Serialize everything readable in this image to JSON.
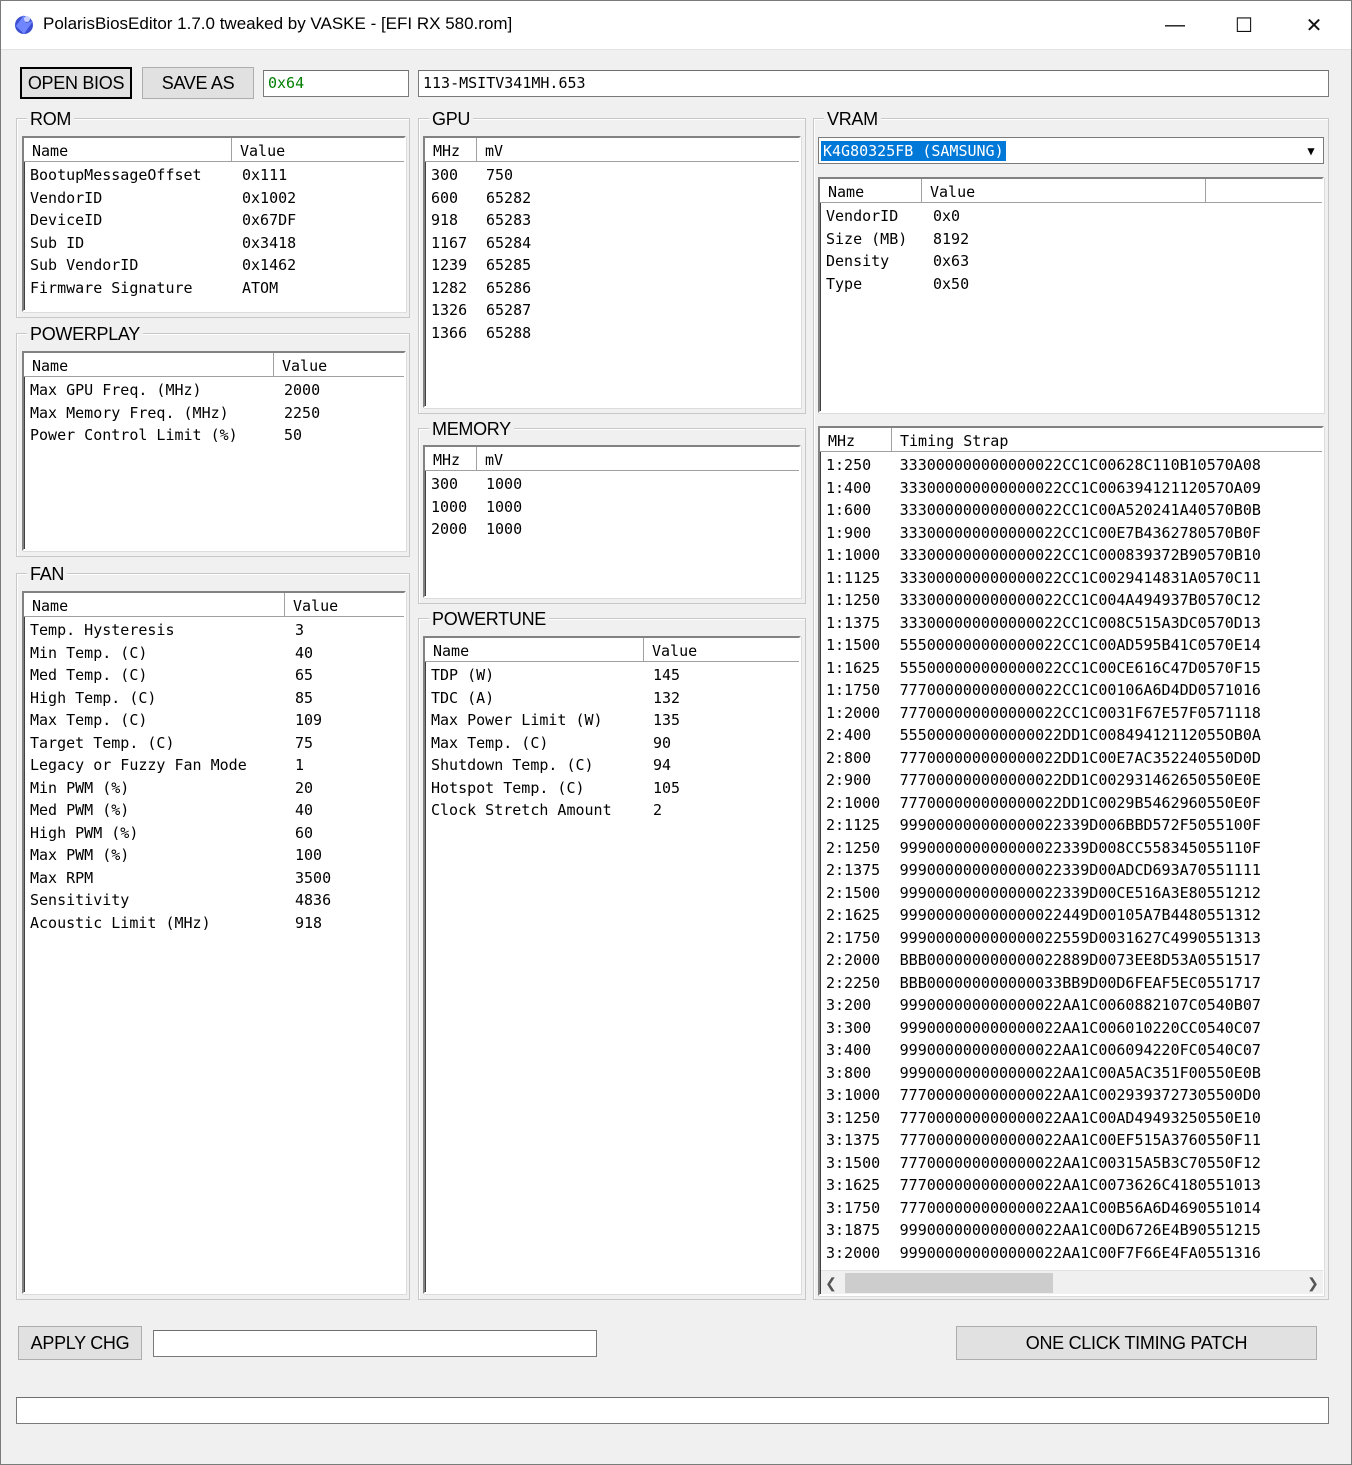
{
  "window": {
    "title": "PolarisBiosEditor 1.7.0 tweaked by VASKE - [EFI RX 580.rom]",
    "minimize": "—",
    "maximize": "☐",
    "close": "✕"
  },
  "toolbar": {
    "open_bios": "OPEN BIOS",
    "save_as": "SAVE AS",
    "checksum": "0x64",
    "checksum_color": "#008000",
    "bios_part_number": "113-MSITV341MH.653"
  },
  "rom": {
    "label": "ROM",
    "columns": [
      "Name",
      "Value"
    ],
    "rows": [
      [
        "BootupMessageOffset",
        "0x111"
      ],
      [
        "VendorID",
        "0x1002"
      ],
      [
        "DeviceID",
        "0x67DF"
      ],
      [
        "Sub ID",
        "0x3418"
      ],
      [
        "Sub VendorID",
        "0x1462"
      ],
      [
        "Firmware Signature",
        "ATOM"
      ]
    ]
  },
  "powerplay": {
    "label": "POWERPLAY",
    "columns": [
      "Name",
      "Value"
    ],
    "rows": [
      [
        "Max GPU Freq. (MHz)",
        "2000"
      ],
      [
        "Max Memory Freq. (MHz)",
        "2250"
      ],
      [
        "Power Control Limit (%)",
        "50"
      ]
    ]
  },
  "fan": {
    "label": "FAN",
    "columns": [
      "Name",
      "Value"
    ],
    "rows": [
      [
        "Temp. Hysteresis",
        "3"
      ],
      [
        "Min Temp. (C)",
        "40"
      ],
      [
        "Med Temp. (C)",
        "65"
      ],
      [
        "High Temp. (C)",
        "85"
      ],
      [
        "Max Temp. (C)",
        "109"
      ],
      [
        "Target Temp. (C)",
        "75"
      ],
      [
        "Legacy or Fuzzy Fan Mode",
        "1"
      ],
      [
        "Min PWM (%)",
        "20"
      ],
      [
        "Med PWM (%)",
        "40"
      ],
      [
        "High PWM (%)",
        "60"
      ],
      [
        "Max PWM (%)",
        "100"
      ],
      [
        "Max RPM",
        "3500"
      ],
      [
        "Sensitivity",
        "4836"
      ],
      [
        "Acoustic Limit (MHz)",
        "918"
      ]
    ]
  },
  "gpu": {
    "label": "GPU",
    "columns": [
      "MHz",
      "mV"
    ],
    "rows": [
      [
        "300",
        "750"
      ],
      [
        "600",
        "65282"
      ],
      [
        "918",
        "65283"
      ],
      [
        "1167",
        "65284"
      ],
      [
        "1239",
        "65285"
      ],
      [
        "1282",
        "65286"
      ],
      [
        "1326",
        "65287"
      ],
      [
        "1366",
        "65288"
      ]
    ]
  },
  "memory": {
    "label": "MEMORY",
    "columns": [
      "MHz",
      "mV"
    ],
    "rows": [
      [
        "300",
        "1000"
      ],
      [
        "1000",
        "1000"
      ],
      [
        "2000",
        "1000"
      ]
    ]
  },
  "powertune": {
    "label": "POWERTUNE",
    "columns": [
      "Name",
      "Value"
    ],
    "rows": [
      [
        "TDP (W)",
        "145"
      ],
      [
        "TDC (A)",
        "132"
      ],
      [
        "Max Power Limit (W)",
        "135"
      ],
      [
        "Max Temp. (C)",
        "90"
      ],
      [
        "Shutdown Temp. (C)",
        "94"
      ],
      [
        "Hotspot Temp. (C)",
        "105"
      ],
      [
        "Clock Stretch Amount",
        "2"
      ]
    ]
  },
  "vram": {
    "label": "VRAM",
    "selected": "K4G80325FB (SAMSUNG)",
    "columns": [
      "Name",
      "Value"
    ],
    "rows": [
      [
        "VendorID",
        "0x0"
      ],
      [
        "Size (MB)",
        "8192"
      ],
      [
        "Density",
        "0x63"
      ],
      [
        "Type",
        "0x50"
      ]
    ],
    "timing_columns": [
      "MHz",
      "Timing Strap"
    ],
    "timings": [
      [
        "1:250",
        "333000000000000022CC1C00628C110B10570A08"
      ],
      [
        "1:400",
        "333000000000000022CC1C00639412112057OA09"
      ],
      [
        "1:600",
        "333000000000000022CC1C00A520241A40570B0B"
      ],
      [
        "1:900",
        "333000000000000022CC1C00E7B4362780570B0F"
      ],
      [
        "1:1000",
        "333000000000000022CC1C000839372B90570B10"
      ],
      [
        "1:1125",
        "333000000000000022CC1C0029414831A0570C11"
      ],
      [
        "1:1250",
        "333000000000000022CC1C004A494937B0570C12"
      ],
      [
        "1:1375",
        "333000000000000022CC1C008C515A3DC0570D13"
      ],
      [
        "1:1500",
        "555000000000000022CC1C00AD595B41C0570E14"
      ],
      [
        "1:1625",
        "555000000000000022CC1C00CE616C47D0570F15"
      ],
      [
        "1:1750",
        "777000000000000022CC1C00106A6D4DD0571016"
      ],
      [
        "1:2000",
        "777000000000000022CC1C0031F67E57F0571118"
      ],
      [
        "2:400",
        "555000000000000022DD1C00849412112055OB0A"
      ],
      [
        "2:800",
        "777000000000000022DD1C00E7AC352240550D0D"
      ],
      [
        "2:900",
        "777000000000000022DD1C002931462650550E0E"
      ],
      [
        "2:1000",
        "777000000000000022DD1C0029B5462960550E0F"
      ],
      [
        "2:1125",
        "999000000000000022339D006BBD572F5055100F"
      ],
      [
        "2:1250",
        "999000000000000022339D008CC558345055110F"
      ],
      [
        "2:1375",
        "999000000000000022339D00ADCD693A70551111"
      ],
      [
        "2:1500",
        "999000000000000022339D00CE516A3E80551212"
      ],
      [
        "2:1625",
        "999000000000000022449D00105A7B4480551312"
      ],
      [
        "2:1750",
        "999000000000000022559D0031627C4990551313"
      ],
      [
        "2:2000",
        "BBB000000000000022889D0073EE8D53A0551517"
      ],
      [
        "2:2250",
        "BBB000000000000033BB9D00D6FEAF5EC0551717"
      ],
      [
        "3:200",
        "999000000000000022AA1C0060882107C0540B07"
      ],
      [
        "3:300",
        "999000000000000022AA1C006010220CC0540C07"
      ],
      [
        "3:400",
        "999000000000000022AA1C006094220FC0540C07"
      ],
      [
        "3:800",
        "999000000000000022AA1C00A5AC351F00550E0B"
      ],
      [
        "3:1000",
        "777000000000000022AA1C0029393727305500D0"
      ],
      [
        "3:1250",
        "777000000000000022AA1C00AD49493250550E10"
      ],
      [
        "3:1375",
        "777000000000000022AA1C00EF515A3760550F11"
      ],
      [
        "3:1500",
        "777000000000000022AA1C00315A5B3C70550F12"
      ],
      [
        "3:1625",
        "777000000000000022AA1C0073626C4180551013"
      ],
      [
        "3:1750",
        "777000000000000022AA1C00B56A6D4690551014"
      ],
      [
        "3:1875",
        "999000000000000022AA1C00D6726E4B90551215"
      ],
      [
        "3:2000",
        "999000000000000022AA1C00F7F66E4FA0551316"
      ]
    ]
  },
  "bottom": {
    "apply_chg": "APPLY CHG",
    "apply_input": "",
    "one_click_timing_patch": "ONE CLICK TIMING PATCH",
    "status": ""
  }
}
